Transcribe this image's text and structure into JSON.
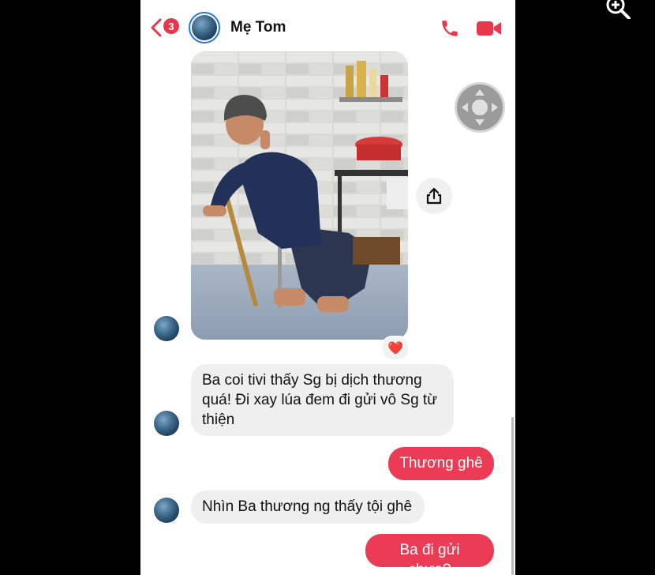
{
  "header": {
    "back_badge": "3",
    "contact_name": "Mẹ Tom",
    "icons": [
      "back-chevron-icon",
      "phone-icon",
      "video-camera-icon"
    ]
  },
  "photo_message": {
    "reaction": "❤️"
  },
  "messages": [
    {
      "direction": "incoming",
      "text": "Ba coi tivi thấy Sg bị dịch thương quá! Đi xay lúa đem đi gửi vô Sg từ thiện"
    },
    {
      "direction": "outgoing",
      "text": "Thương ghê"
    },
    {
      "direction": "incoming",
      "text": "Nhìn Ba thương ng thấy tội ghê"
    },
    {
      "direction": "outgoing",
      "text": "Ba đi gửi chưa?"
    }
  ],
  "colors": {
    "accent": "#e8364c",
    "outgoing_bubble": "#ec3b55",
    "incoming_bubble": "#efefef"
  }
}
